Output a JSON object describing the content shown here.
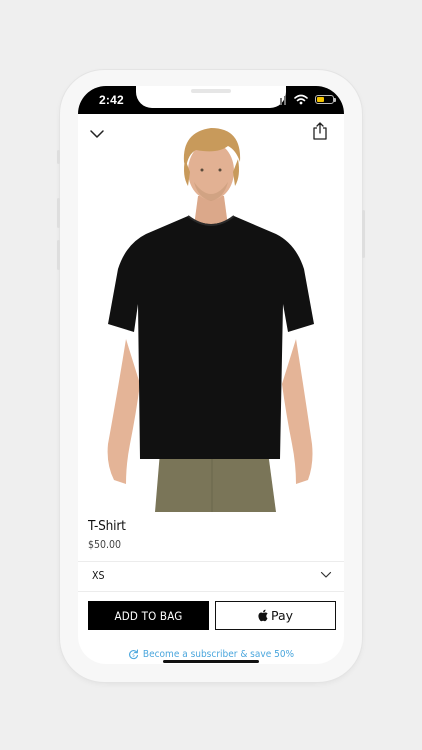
{
  "status_bar": {
    "time": "2:42"
  },
  "product": {
    "title": "T-Shirt",
    "price": "$50.00",
    "image_icon": "person-in-black-tshirt",
    "shirt_color": "#111111",
    "shorts_color": "#7a7558",
    "hair_color": "#c89a5b"
  },
  "size_selector": {
    "value": "XS",
    "icon": "chevron-down-icon"
  },
  "actions": {
    "add_to_bag": "ADD TO BAG",
    "apple_pay": "Pay",
    "apple_pay_icon": "apple-icon"
  },
  "subscribe": {
    "text": "Become a subscriber & save 50%",
    "icon": "refresh-icon",
    "color": "#4aa6dd"
  },
  "nav": {
    "close_icon": "chevron-down-icon",
    "share_icon": "share-icon"
  }
}
